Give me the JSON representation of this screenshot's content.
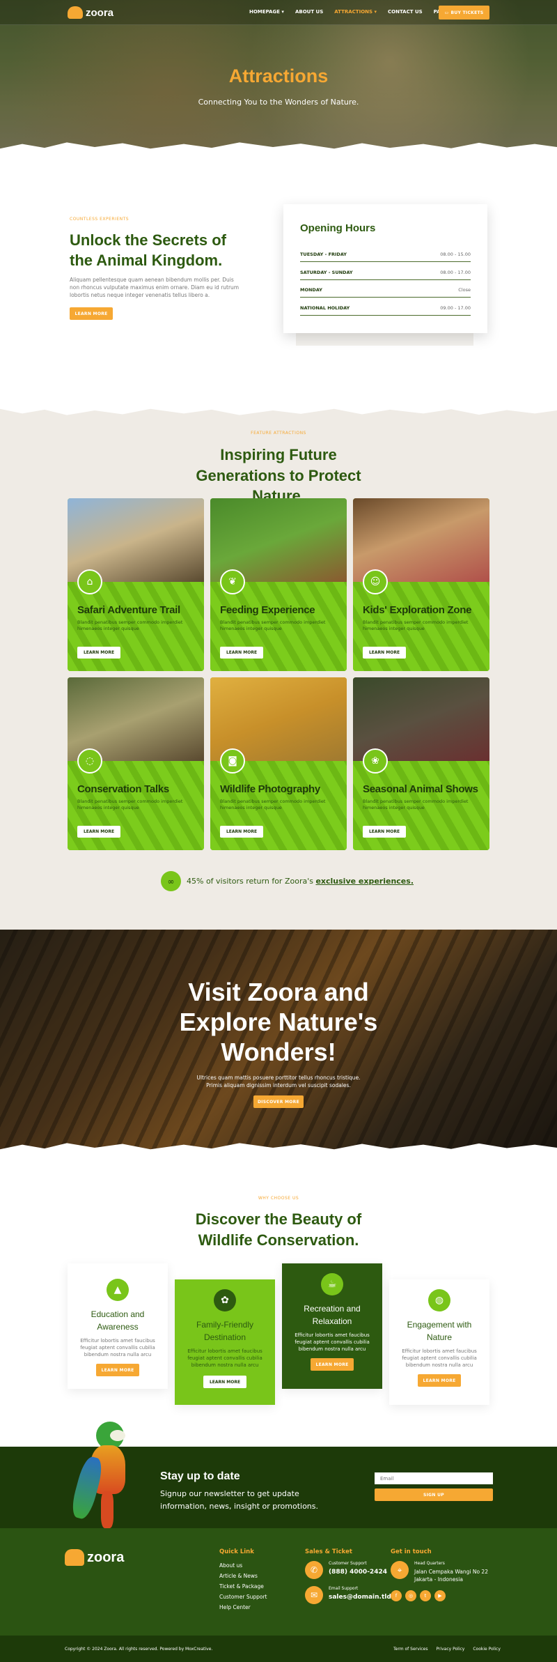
{
  "brand": {
    "name": "zoora"
  },
  "nav": {
    "items": [
      {
        "label": "HOMEPAGE",
        "dropdown": true
      },
      {
        "label": "ABOUT US",
        "dropdown": false
      },
      {
        "label": "ATTRACTIONS",
        "dropdown": true,
        "active": true
      },
      {
        "label": "CONTACT US",
        "dropdown": false
      },
      {
        "label": "PAGES",
        "dropdown": true
      }
    ],
    "cta": "BUY TICKETS"
  },
  "hero": {
    "title": "Attractions",
    "subtitle": "Connecting You to the Wonders of Nature."
  },
  "intro": {
    "eyebrow": "COUNTLESS EXPERIENTS",
    "heading": "Unlock the Secrets of the Animal Kingdom.",
    "text": "Aliquam pellentesque quam aenean bibendum mollis per. Duis non rhoncus vulputate maximus enim ornare. Diam eu id rutrum lobortis netus neque integer venenatis tellus libero a.",
    "button": "LEARN MORE"
  },
  "hours": {
    "title": "Opening Hours",
    "rows": [
      {
        "day": "TUESDAY - FRIDAY",
        "time": "08.00 - 15.00"
      },
      {
        "day": "SATURDAY - SUNDAY",
        "time": "08.00 - 17.00"
      },
      {
        "day": "MONDAY",
        "time": "Close"
      },
      {
        "day": "NATIONAL HOLIDAY",
        "time": "09.00 - 17.00"
      }
    ]
  },
  "attractions": {
    "eyebrow": "FEATURE ATTRACTIONS",
    "heading": "Inspiring Future Generations to Protect Nature.",
    "cards": [
      {
        "title": "Safari Adventure Trail",
        "text": "Blandit penatibus semper commodo imperdiet himenaeos integer quisque",
        "button": "LEARN MORE",
        "icon": "safari-hat-icon"
      },
      {
        "title": "Feeding Experience",
        "text": "Blandit penatibus semper commodo imperdiet himenaeos integer quisque",
        "button": "LEARN MORE",
        "icon": "leaf-icon"
      },
      {
        "title": "Kids' Exploration Zone",
        "text": "Blandit penatibus semper commodo imperdiet himenaeos integer quisque",
        "button": "LEARN MORE",
        "icon": "smiley-icon"
      },
      {
        "title": "Conservation Talks",
        "text": "Blandit penatibus semper commodo imperdiet himenaeos integer quisque",
        "button": "LEARN MORE",
        "icon": "chat-bubble-icon"
      },
      {
        "title": "Wildlife Photography",
        "text": "Blandit penatibus semper commodo imperdiet himenaeos integer quisque",
        "button": "LEARN MORE",
        "icon": "camera-icon"
      },
      {
        "title": "Seasonal Animal Shows",
        "text": "Blandit penatibus semper commodo imperdiet himenaeos integer quisque",
        "button": "LEARN MORE",
        "icon": "paw-icon"
      }
    ],
    "stat_text": "45% of visitors return for Zoora's ",
    "stat_link": "exclusive experiences."
  },
  "banner": {
    "heading": "Visit Zoora and Explore Nature's Wonders!",
    "text": "Ultrices quam mattis posuere porttitor tellus rhoncus tristique. Primis aliquam dignissim interdum vel suscipit sodales.",
    "button": "DISCOVER MORE"
  },
  "why": {
    "eyebrow": "WHY CHOOSE US",
    "heading": "Discover the Beauty of Wildlife Conservation.",
    "cards": [
      {
        "title": "Education and Awareness",
        "text": "Efficitur lobortis amet faucibus feugiat aptent convallis cubilia bibendum nostra nulla arcu",
        "button": "LEARN MORE"
      },
      {
        "title": "Family-Friendly Destination",
        "text": "Efficitur lobortis amet faucibus feugiat aptent convallis cubilia bibendum nostra nulla arcu",
        "button": "LEARN MORE"
      },
      {
        "title": "Recreation and Relaxation",
        "text": "Efficitur lobortis amet faucibus feugiat aptent convallis cubilia bibendum nostra nulla arcu",
        "button": "LEARN MORE"
      },
      {
        "title": "Engagement with Nature",
        "text": "Efficitur lobortis amet faucibus feugiat aptent convallis cubilia bibendum nostra nulla arcu",
        "button": "LEARN MORE"
      }
    ]
  },
  "newsletter": {
    "title": "Stay up to date",
    "text": "Signup our newsletter to get update information, news, insight or promotions.",
    "placeholder": "Email",
    "button": "SIGN UP"
  },
  "footer": {
    "quick_title": "Quick Link",
    "quick_links": [
      "About us",
      "Article & News",
      "Ticket & Package",
      "Customer Support",
      "Help Center"
    ],
    "sales_title": "Sales & Ticket",
    "support_label": "Customer Support",
    "support_value": "(888) 4000-2424",
    "email_label": "Email Support",
    "email_value": "sales@domain.tld",
    "touch_title": "Get in touch",
    "hq_label": "Head Quarters",
    "hq_value": "Jalan Cempaka Wangi No 22 Jakarta - Indonesia",
    "copyright": "Copyright © 2024 Zoora. All rights reserved. Powered by MoxCreative.",
    "legal": [
      "Term of Services",
      "Privacy Policy",
      "Cookie Policy"
    ]
  },
  "colors": {
    "accent": "#f6a833",
    "green": "#79c51a",
    "dark_green": "#1e3a0a"
  }
}
